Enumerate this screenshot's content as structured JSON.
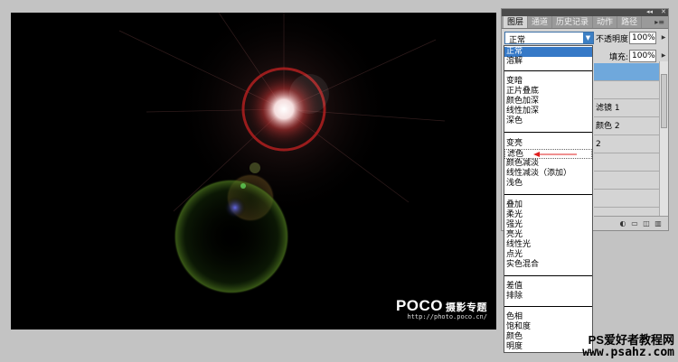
{
  "canvas": {
    "logo_brand": "POCO",
    "logo_sub": "摄影专题",
    "logo_url": "http://photo.poco.cn/"
  },
  "panel": {
    "tabs": [
      "图层",
      "通道",
      "历史记录",
      "动作",
      "路径"
    ],
    "collapse_icon": "◂◂",
    "close_icon": "✕",
    "menu_icon": "▸≡",
    "blend_mode_value": "正常",
    "opacity_label": "不透明度:",
    "opacity_value": "100%",
    "fill_label": "填充:",
    "fill_value": "100%",
    "layer_rows": [
      "滤镜 1",
      "颜色 2",
      "2"
    ]
  },
  "blend_modes": {
    "group1": [
      "正常",
      "溶解"
    ],
    "group2": [
      "变暗",
      "正片叠底",
      "颜色加深",
      "线性加深",
      "深色"
    ],
    "group3": [
      "变亮",
      "滤色",
      "颜色减淡",
      "线性减淡（添加）",
      "浅色"
    ],
    "group4": [
      "叠加",
      "柔光",
      "强光",
      "亮光",
      "线性光",
      "点光",
      "实色混合"
    ],
    "group5": [
      "差值",
      "排除"
    ],
    "group6": [
      "色相",
      "饱和度",
      "颜色",
      "明度"
    ],
    "highlighted": "正常",
    "pointed": "滤色"
  },
  "watermark": {
    "line1": "PS爱好者教程网",
    "line2": "www.psahz.com"
  },
  "colors": {
    "highlight": "#3679c7",
    "arrow": "#e02020",
    "canvas": "#000000"
  }
}
